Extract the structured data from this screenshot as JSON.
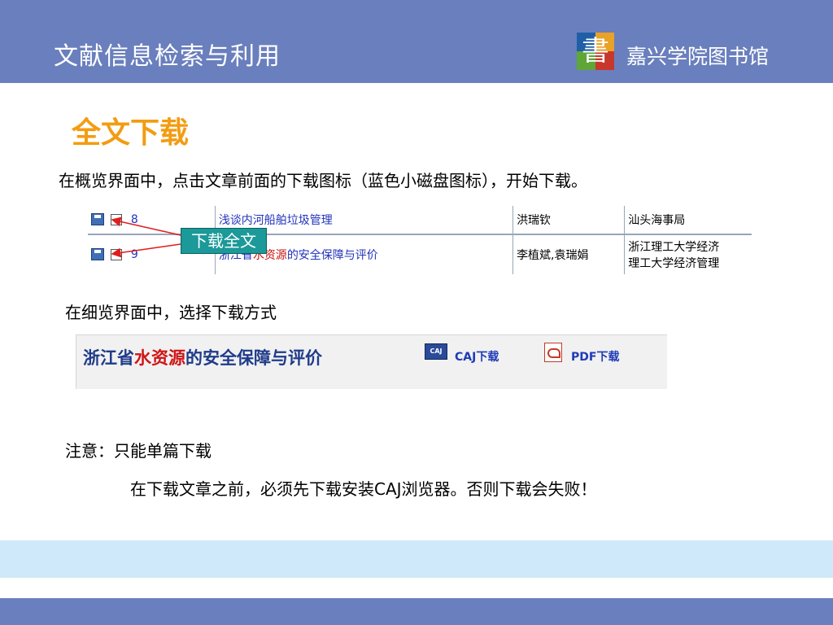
{
  "header": {
    "course_title": "文献信息检索与利用",
    "library_logo_char": "書",
    "library_name": "嘉兴学院图书馆"
  },
  "section_title": "全文下载",
  "instructions": {
    "overview": "在概览界面中，点击文章前面的下载图标（蓝色小磁盘图标），开始下载。",
    "detail": "在细览界面中，选择下载方式",
    "note_label": "注意：只能单篇下载",
    "note_detail": "在下载文章之前，必须先下载安装CAJ浏览器。否则下载会失败！"
  },
  "result_list": {
    "rows": [
      {
        "number": "8",
        "title": "浅谈内河船舶垃圾管理",
        "authors": "洪瑞钦",
        "institution": "汕头海事局"
      },
      {
        "number": "9",
        "title_plain_pre": "浙江省",
        "title_highlight": "水资源",
        "title_plain_post": "的安全保障与评价",
        "authors": "李植斌,袁瑞娟",
        "institution_line1": "浙江理工大学经济",
        "institution_line2": "理工大学经济管理"
      }
    ],
    "callout": "下载全文"
  },
  "detail_view": {
    "title_pre": "浙江省",
    "title_highlight": "水资源",
    "title_post": "的安全保障与评价",
    "caj_icon_text": "CAJ",
    "caj_label": "CAJ下载",
    "pdf_label": "PDF下载"
  },
  "colors": {
    "header_bar": "#6a7fbd",
    "section_title": "#f39c12",
    "callout_bg": "#1c9999",
    "bottom_band": "#cfe9fa"
  }
}
